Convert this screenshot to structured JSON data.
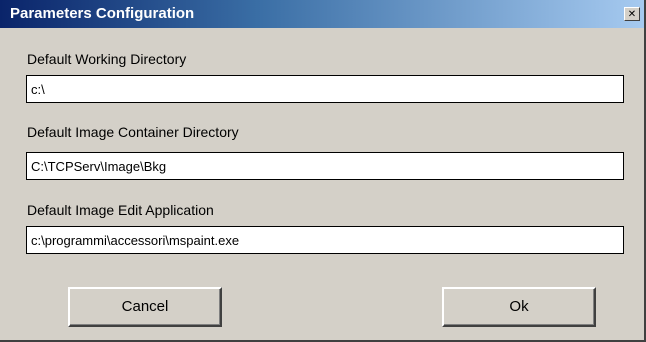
{
  "window": {
    "title": "Parameters Configuration",
    "close_glyph": "✕"
  },
  "fields": [
    {
      "label": "Default Working Directory",
      "value": "c:\\"
    },
    {
      "label": "Default Image Container Directory",
      "value": "C:\\TCPServ\\Image\\Bkg"
    },
    {
      "label": "Default Image Edit Application",
      "value": "c:\\programmi\\accessori\\mspaint.exe"
    }
  ],
  "buttons": {
    "cancel": "Cancel",
    "ok": "Ok"
  },
  "colors": {
    "dialog_bg": "#d4d0c8",
    "title_start": "#0a246a",
    "title_end": "#a6caf0"
  }
}
